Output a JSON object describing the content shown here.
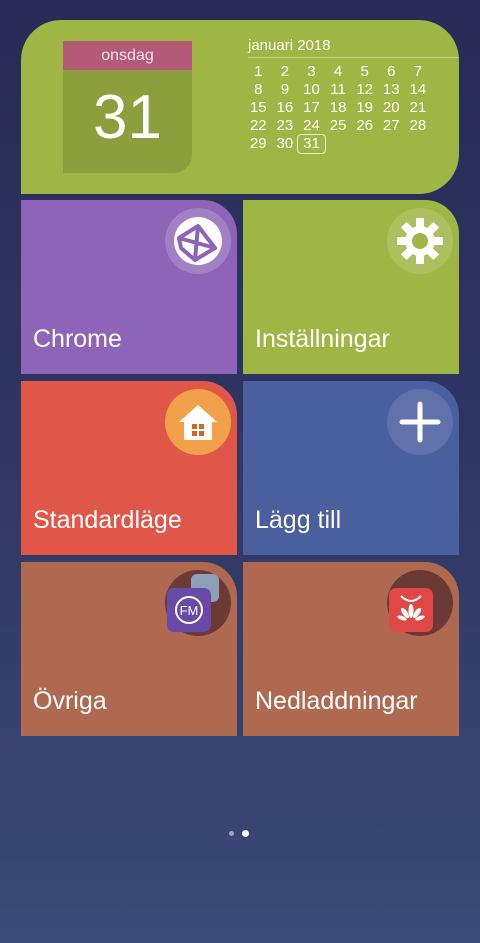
{
  "calendar": {
    "weekday": "onsdag",
    "date": "31",
    "month_title": "januari 2018",
    "weeks": [
      [
        "1",
        "2",
        "3",
        "4",
        "5",
        "6",
        "7"
      ],
      [
        "8",
        "9",
        "10",
        "11",
        "12",
        "13",
        "14"
      ],
      [
        "15",
        "16",
        "17",
        "18",
        "19",
        "20",
        "21"
      ],
      [
        "22",
        "23",
        "24",
        "25",
        "26",
        "27",
        "28"
      ],
      [
        "29",
        "30",
        "31",
        "",
        "",
        "",
        ""
      ]
    ],
    "today": "31"
  },
  "tiles": [
    {
      "label": "Chrome",
      "icon": "globe-icon",
      "color": "#8d64b8"
    },
    {
      "label": "Inställningar",
      "icon": "gear-icon",
      "color": "#9fb644"
    },
    {
      "label": "Standardläge",
      "icon": "home-icon",
      "color": "#e0574a"
    },
    {
      "label": "Lägg till",
      "icon": "plus-icon",
      "color": "#4a5f9e"
    },
    {
      "label": "Övriga",
      "icon": "folder-fm-icon",
      "color": "#b06951"
    },
    {
      "label": "Nedladdningar",
      "icon": "appgallery-icon",
      "color": "#b06951"
    }
  ],
  "pager": {
    "pages": 2,
    "current": 2
  }
}
